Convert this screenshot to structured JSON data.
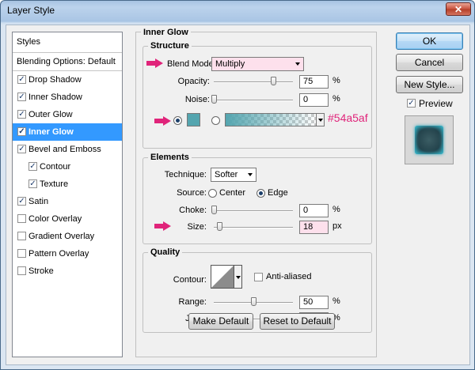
{
  "window": {
    "title": "Layer Style",
    "close_glyph": "✕"
  },
  "styles_panel": {
    "header": "Styles",
    "blending": "Blending Options: Default",
    "items": [
      {
        "label": "Drop Shadow",
        "checked": true
      },
      {
        "label": "Inner Shadow",
        "checked": true
      },
      {
        "label": "Outer Glow",
        "checked": true
      },
      {
        "label": "Inner Glow",
        "checked": true,
        "selected": true
      },
      {
        "label": "Bevel and Emboss",
        "checked": true
      },
      {
        "label": "Contour",
        "checked": true,
        "sub": true
      },
      {
        "label": "Texture",
        "checked": true,
        "sub": true
      },
      {
        "label": "Satin",
        "checked": true
      },
      {
        "label": "Color Overlay",
        "checked": false
      },
      {
        "label": "Gradient Overlay",
        "checked": false
      },
      {
        "label": "Pattern Overlay",
        "checked": false
      },
      {
        "label": "Stroke",
        "checked": false
      }
    ]
  },
  "inner_glow": {
    "section_title": "Inner Glow",
    "structure": {
      "title": "Structure",
      "blend_mode_label": "Blend Mode:",
      "blend_mode_value": "Multiply",
      "opacity_label": "Opacity:",
      "opacity_value": "75",
      "opacity_unit": "%",
      "opacity_level": 0.75,
      "noise_label": "Noise:",
      "noise_value": "0",
      "noise_unit": "%",
      "noise_level": 0,
      "color_hex_annotation": "#54a5af",
      "glow_color": "#54a5af"
    },
    "elements": {
      "title": "Elements",
      "technique_label": "Technique:",
      "technique_value": "Softer",
      "source_label": "Source:",
      "source_center": "Center",
      "source_edge": "Edge",
      "choke_label": "Choke:",
      "choke_value": "0",
      "choke_unit": "%",
      "choke_level": 0,
      "size_label": "Size:",
      "size_value": "18",
      "size_unit": "px",
      "size_level": 0.07
    },
    "quality": {
      "title": "Quality",
      "contour_label": "Contour:",
      "antialiased_label": "Anti-aliased",
      "range_label": "Range:",
      "range_value": "50",
      "range_unit": "%",
      "range_level": 0.5,
      "jitter_label": "Jitter:",
      "jitter_value": "0",
      "jitter_unit": "%",
      "jitter_level": 0
    },
    "make_default": "Make Default",
    "reset_default": "Reset to Default"
  },
  "actions": {
    "ok": "OK",
    "cancel": "Cancel",
    "new_style": "New Style...",
    "preview_label": "Preview"
  },
  "colors": {
    "accent": "#54a5af",
    "annotation_pink": "#e0247a",
    "selection": "#3399ff"
  }
}
